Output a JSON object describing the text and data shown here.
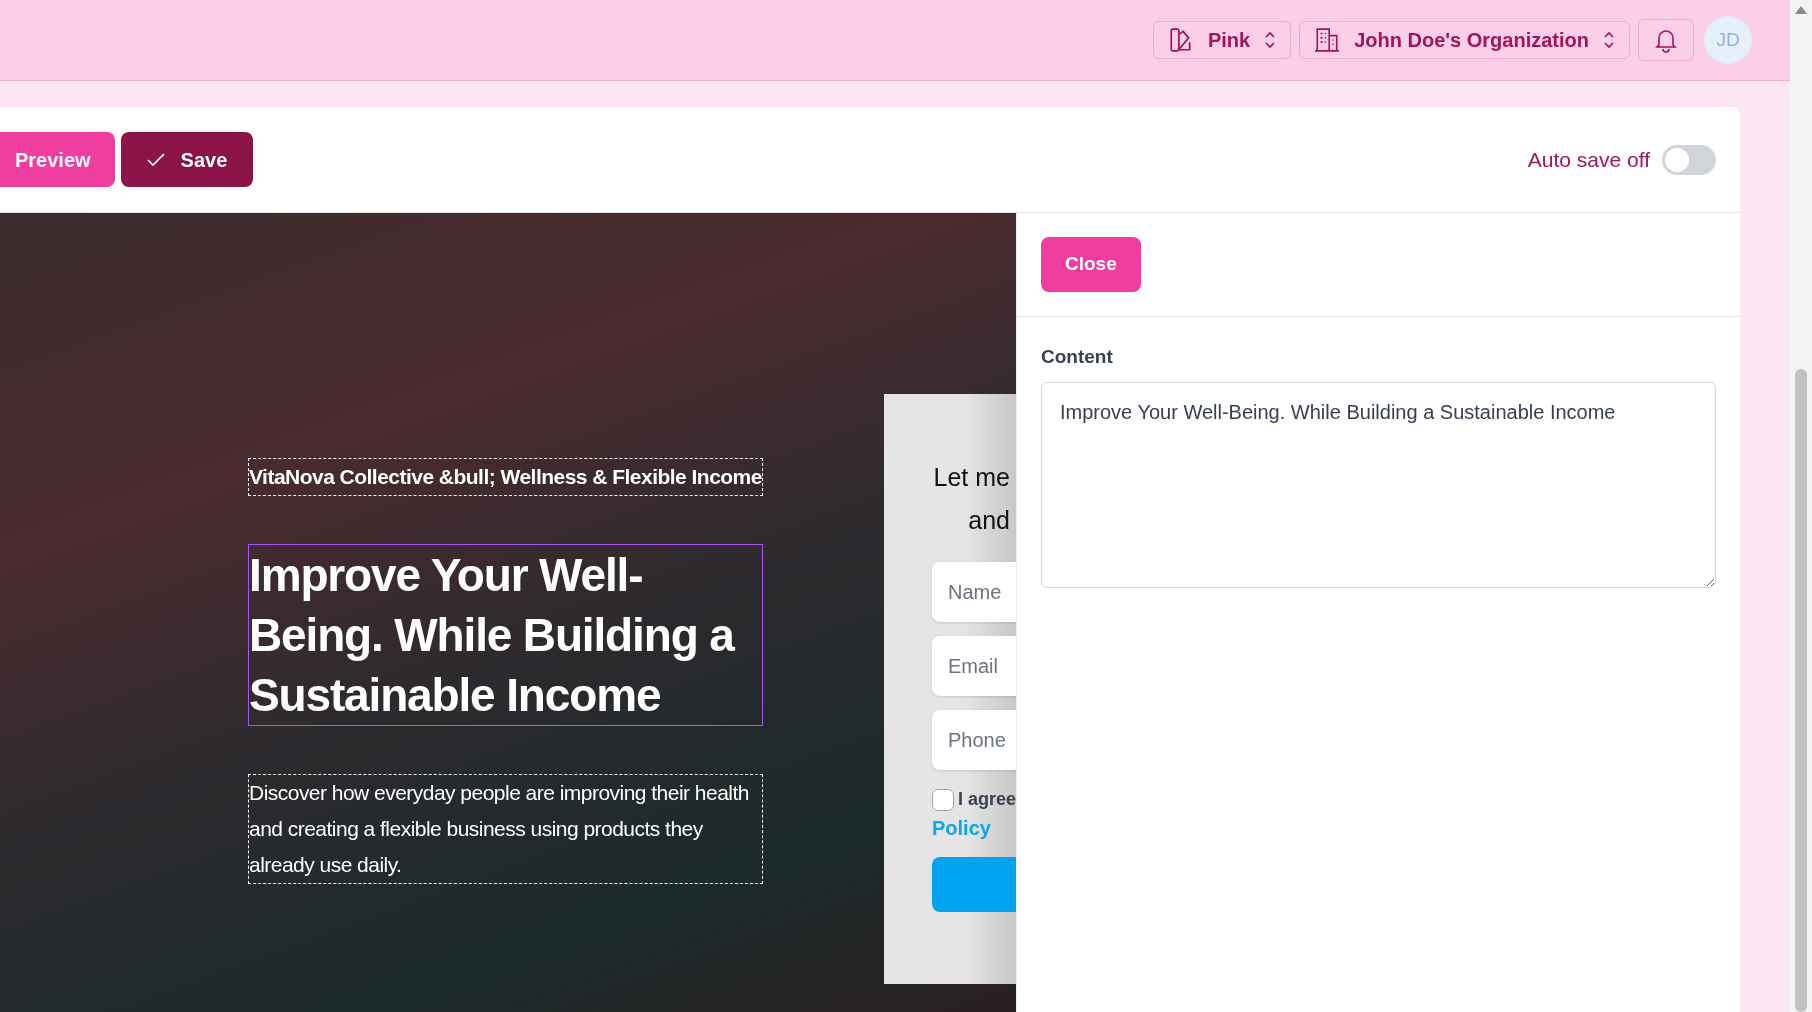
{
  "topbar": {
    "theme_selector": "Pink",
    "org_selector": "John Doe's Organization",
    "avatar": "JD"
  },
  "toolbar": {
    "buttons": [
      {
        "label": "Preview",
        "kind": "primary"
      },
      {
        "label": "Save",
        "kind": "save"
      }
    ],
    "auto_save": {
      "label": "Auto save off",
      "on": false
    }
  },
  "canvas": {
    "blocks": [
      {
        "kind": "subtitle",
        "text": "VitaNova Collective &bull; Wellness & Flexible Income",
        "selected": false
      },
      {
        "kind": "title",
        "text": "Improve Your Well-Being. While Building a Sustainable Income",
        "selected": true
      },
      {
        "kind": "description",
        "text": "Discover how everyday people are improving their health and creating a flexible business using products they already use daily.",
        "selected": false
      }
    ],
    "form": {
      "heading_lines": [
        "Let me",
        "and"
      ],
      "fields": [
        {
          "placeholder": "Name"
        },
        {
          "placeholder": "Email"
        },
        {
          "placeholder": "Phone"
        }
      ],
      "consent": {
        "text": "I agree",
        "checked": false
      },
      "link": "Policy"
    }
  },
  "editor": {
    "close": "Close",
    "field_label": "Content",
    "value": "Improve Your Well-Being. While Building a Sustainable Income"
  }
}
